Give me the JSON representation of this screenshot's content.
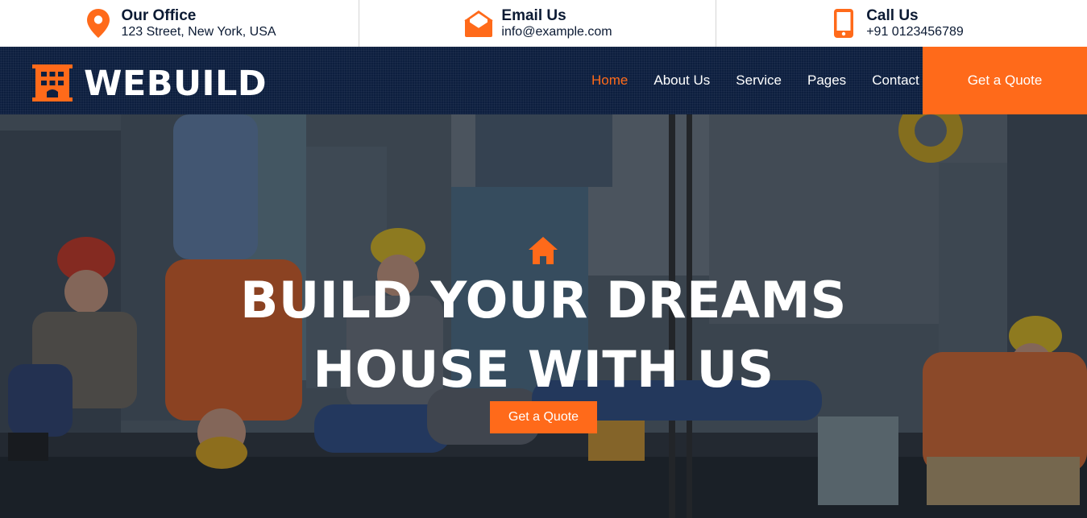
{
  "topbar": {
    "office": {
      "title": "Our Office",
      "detail": "123 Street, New York, USA",
      "icon": "map-marker-icon"
    },
    "email": {
      "title": "Email Us",
      "detail": "info@example.com",
      "icon": "envelope-open-icon"
    },
    "call": {
      "title": "Call Us",
      "detail": "+91 0123456789",
      "icon": "mobile-phone-icon"
    }
  },
  "brand": {
    "name": "WEBUILD",
    "icon": "building-icon"
  },
  "nav": {
    "items": [
      {
        "label": "Home",
        "active": true
      },
      {
        "label": "About Us",
        "active": false
      },
      {
        "label": "Service",
        "active": false
      },
      {
        "label": "Pages",
        "active": false
      },
      {
        "label": "Contact",
        "active": false
      }
    ],
    "quote_label": "Get a Quote"
  },
  "hero": {
    "icon": "home-icon",
    "headline_line1": "BUILD YOUR DREAMS",
    "headline_line2": "HOUSE WITH US",
    "button_label": "Get a Quote"
  },
  "colors": {
    "accent": "#ff6a1a",
    "navy": "#0d1f3f",
    "text_dark": "#0b1a33"
  }
}
